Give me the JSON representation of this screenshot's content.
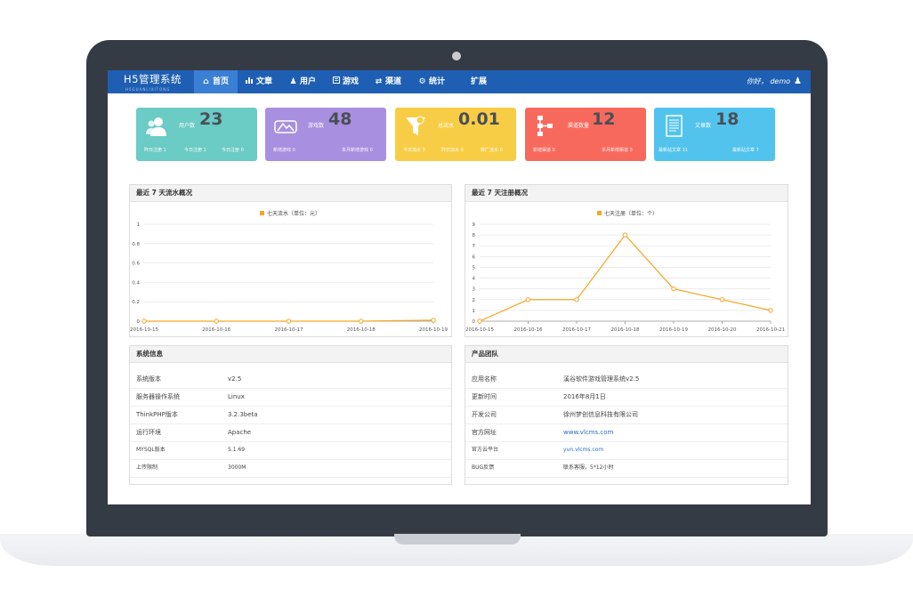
{
  "nav": {
    "brand_title": "H5管理系统",
    "brand_subtitle": "H5GUANLIXITONG",
    "items": [
      {
        "label": "首页",
        "icon": "home-icon",
        "active": true
      },
      {
        "label": "文章",
        "icon": "bar-chart-icon"
      },
      {
        "label": "用户",
        "icon": "user-icon"
      },
      {
        "label": "游戏",
        "icon": "book-icon"
      },
      {
        "label": "渠道",
        "icon": "share-icon"
      },
      {
        "label": "统计",
        "icon": "gear-icon"
      },
      {
        "label": "扩展",
        "icon": ""
      }
    ],
    "greeting": "你好， demo",
    "user_icon": "user-icon"
  },
  "cards": [
    {
      "label": "用户数",
      "value": "23",
      "sub_left": "昨日注册 1",
      "sub_mid": "今日注册 1",
      "sub_right": "今日注册 0",
      "color": "#6bcbc5",
      "icon": "users-icon"
    },
    {
      "label": "游戏数",
      "value": "48",
      "sub_left": "新增游戏 0",
      "sub_mid": "",
      "sub_right": "本月新增游戏 0",
      "color": "#a98fdf",
      "icon": "game-controller-icon"
    },
    {
      "label": "总流水",
      "value": "0.01",
      "sub_left": "今日流水 0",
      "sub_mid": "昨日流水 0",
      "sub_right": "推广流水 0",
      "color": "#f8cd46",
      "icon": "funnel-icon"
    },
    {
      "label": "渠道数量",
      "value": "12",
      "sub_left": "新增渠道 0",
      "sub_mid": "",
      "sub_right": "本月新增渠道 3",
      "color": "#f8695d",
      "icon": "sitemap-icon"
    },
    {
      "label": "文章数",
      "value": "18",
      "sub_left": "最新站文章 11",
      "sub_mid": "",
      "sub_right": "最新站文章 7",
      "color": "#52c3ed",
      "icon": "document-icon"
    }
  ],
  "panels": {
    "flow_title": "最近 7 天流水概况",
    "reg_title": "最近 7 天注册概况",
    "sysinfo_title": "系统信息",
    "team_title": "产品团队"
  },
  "charts": {
    "legend_color": "#f5a623"
  },
  "chart_data": [
    {
      "type": "line",
      "title": "最近 7 天流水概况",
      "series": [
        {
          "name": "七天流水（单位：元）",
          "values": [
            0,
            0,
            0,
            0,
            0.01
          ]
        }
      ],
      "x": [
        "2016-10-15",
        "2016-10-16",
        "2016-10-17",
        "2016-10-18",
        "2016-10-19"
      ],
      "y_ticks": [
        "0",
        "0.2",
        "0.4",
        "0.6",
        "0.8",
        "1"
      ],
      "ylim": [
        0,
        1
      ],
      "grid": true,
      "legend": "top-center"
    },
    {
      "type": "line",
      "title": "最近 7 天注册概况",
      "series": [
        {
          "name": "七天注册（单位：个）",
          "values": [
            0,
            2,
            2,
            8,
            3,
            2,
            1
          ]
        }
      ],
      "x": [
        "2016-10-15",
        "2016-10-16",
        "2016-10-17",
        "2016-10-18",
        "2016-10-19",
        "2016-10-20",
        "2016-10-21"
      ],
      "y_ticks": [
        "0",
        "1",
        "2",
        "3",
        "4",
        "5",
        "6",
        "7",
        "8",
        "9"
      ],
      "ylim": [
        0,
        9
      ],
      "grid": true,
      "legend": "top-center"
    }
  ],
  "sysinfo": [
    {
      "key": "系统版本",
      "value": "v2.5"
    },
    {
      "key": "服务器操作系统",
      "value": "Linux"
    },
    {
      "key": "ThinkPHP版本",
      "value": "3.2.3beta"
    },
    {
      "key": "运行环境",
      "value": "Apache"
    },
    {
      "key": "MYSQL版本",
      "value": "5.1.69"
    },
    {
      "key": "上传限制",
      "value": "3000M"
    }
  ],
  "team": [
    {
      "key": "应用名称",
      "value": "溪谷软件游戏管理系统v2.5"
    },
    {
      "key": "更新时间",
      "value": "2016年8月1日"
    },
    {
      "key": "开发公司",
      "value": "徐州梦创信息科技有限公司"
    },
    {
      "key": "官方网址",
      "value": "www.vlcms.com"
    },
    {
      "key": "官方云平台",
      "value": "yun.vlcms.com"
    },
    {
      "key": "BUG反馈",
      "value": "联系客服，5*12小时"
    }
  ]
}
